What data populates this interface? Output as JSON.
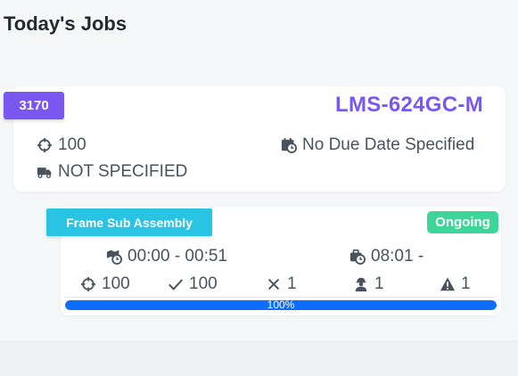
{
  "page": {
    "title": "Today's Jobs"
  },
  "job": {
    "number": "3170",
    "part_number": "LMS-624GC-M",
    "quantity": "100",
    "due_date": "No Due Date Specified",
    "shipping": "NOT SPECIFIED",
    "accent_color": "#7b57f2"
  },
  "operation": {
    "name": "Frame Sub Assembly",
    "status": "Ongoing",
    "status_color": "#3dd698",
    "time_range": "00:00 - 00:51",
    "clock_time": "08:01 -",
    "target": "100",
    "completed": "100",
    "rejected": "1",
    "operators": "1",
    "issues": "1",
    "progress": 1.0,
    "progress_label": "100%"
  },
  "icons": {
    "quantity": "crosshair-icon",
    "due_date": "calendar-clock-icon",
    "shipping": "truck-icon",
    "time_range": "map-clock-icon",
    "clock_time": "briefcase-clock-icon",
    "target": "crosshair-icon",
    "completed": "check-icon",
    "rejected": "x-icon",
    "operators": "worker-icon",
    "issues": "warning-icon"
  }
}
